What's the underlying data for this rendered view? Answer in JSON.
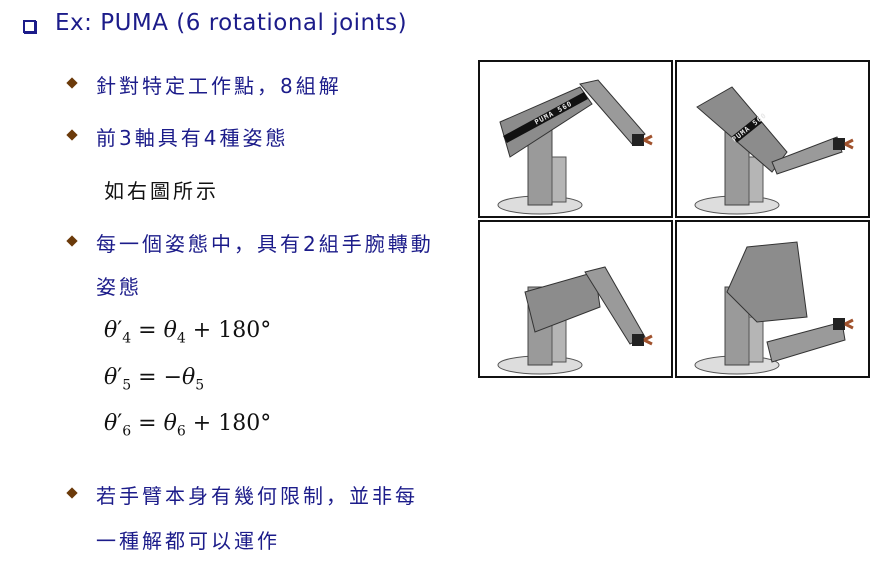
{
  "title": "Ex: PUMA (6 rotational joints)",
  "bullets": [
    {
      "text": "針對特定工作點，8組解"
    },
    {
      "text": "前3軸具有4種姿態"
    },
    {
      "text": "每一個姿態中，具有2組手腕轉動",
      "text2": "姿態"
    },
    {
      "text": "若手臂本身有幾何限制，並非每",
      "text2": "一種解都可以運作"
    }
  ],
  "note": "如右圖所示",
  "equations": [
    {
      "lhs_sub": "4",
      "op": "=",
      "rhs_pre": "",
      "rhs_sub": "4",
      "rhs_post": "+ 180°"
    },
    {
      "lhs_sub": "5",
      "op": "=",
      "rhs_pre": "−",
      "rhs_sub": "5",
      "rhs_post": ""
    },
    {
      "lhs_sub": "6",
      "op": "=",
      "rhs_pre": "",
      "rhs_sub": "6",
      "rhs_post": "+ 180°"
    }
  ],
  "symbol": "θ",
  "robot_label": "PUMA 560",
  "colors": {
    "text": "#1c1c8a",
    "bullet": "#6b3a0a",
    "robot": "#8a8a8a"
  }
}
